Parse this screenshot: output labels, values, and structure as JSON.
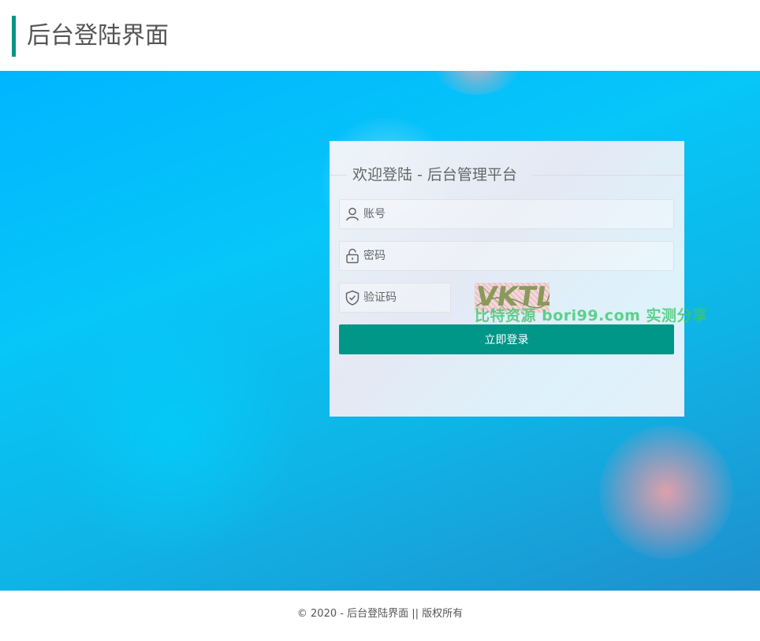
{
  "header": {
    "title": "后台登陆界面"
  },
  "login": {
    "legend": "欢迎登陆 - 后台管理平台",
    "account_placeholder": "账号",
    "password_placeholder": "密码",
    "captcha_placeholder": "验证码",
    "captcha_code": "VKTL",
    "submit_label": "立即登录"
  },
  "icons": {
    "account": "user-icon",
    "password": "lock-icon",
    "captcha": "shield-check-icon"
  },
  "colors": {
    "accent": "#009688",
    "background": "#00c6ff",
    "card": "#f3f4f8"
  },
  "watermark": "比特资源 bori99.com 实测分享",
  "footer": {
    "copyright": "© 2020 - 后台登陆界面 || 版权所有"
  }
}
